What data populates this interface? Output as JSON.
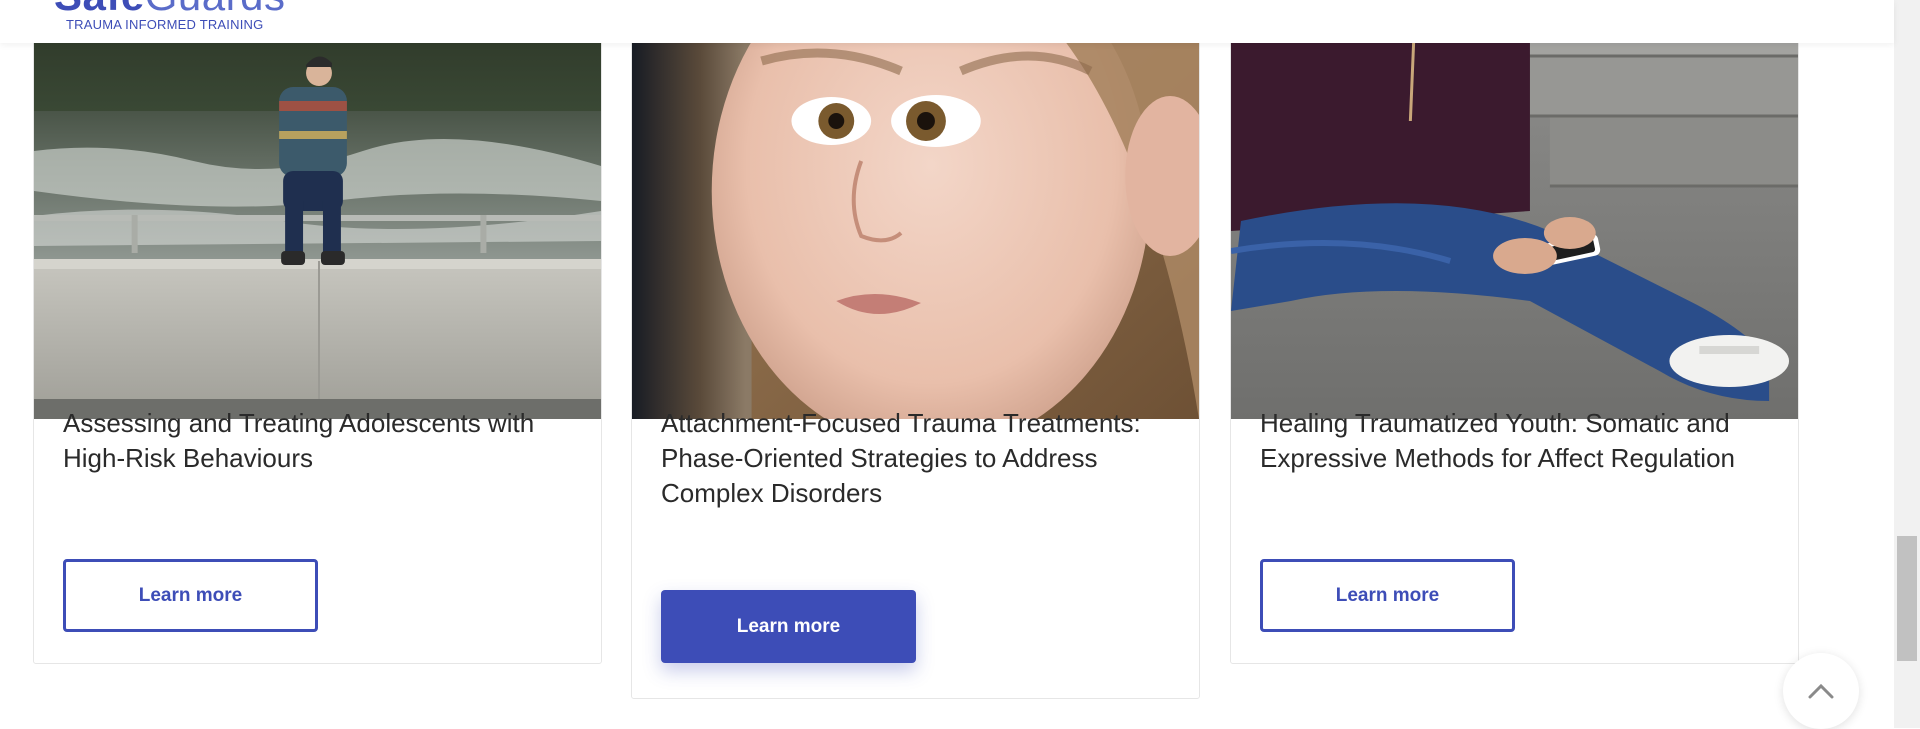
{
  "header": {
    "logo_part1": "Safe",
    "logo_part2": "Guards",
    "tagline": "TRAUMA INFORMED TRAINING"
  },
  "cards": [
    {
      "title": "Assessing and Treating Adolescents with High-Risk Behaviours",
      "button_label": "Learn more",
      "button_style": "outline",
      "image": "teen-sitting-on-riverside-wall"
    },
    {
      "title": "Attachment-Focused Trauma Treatments: Phase-Oriented Strategies to Address Complex Disorders",
      "button_label": "Learn more",
      "button_style": "filled",
      "image": "child-face-closeup"
    },
    {
      "title": "Healing Traumatized Youth: Somatic and Expressive Methods for Affect Regulation",
      "button_label": "Learn more",
      "button_style": "outline",
      "image": "person-with-phone-on-steps"
    }
  ],
  "back_to_top": {
    "icon": "chevron-up-icon"
  },
  "colors": {
    "accent": "#3d4db7",
    "text": "#2a2a2a",
    "border": "#e6e6e6"
  }
}
